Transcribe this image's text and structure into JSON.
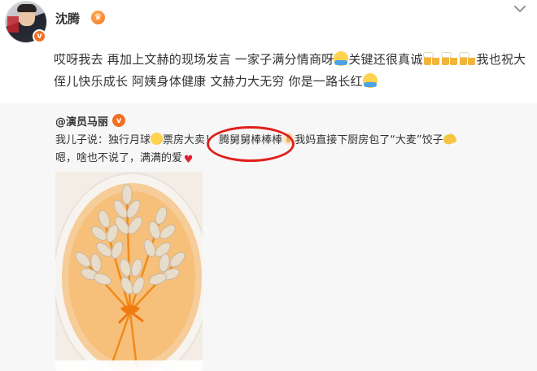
{
  "post": {
    "username": "沈腾",
    "verified_badge": "v",
    "crown_icon": "crown-icon",
    "menu_icon": "chevron-down-icon",
    "text_part1": "哎呀我去 再加上文赫的现场发言 一家子满分情商呀",
    "text_part2": "关键还很真诚",
    "text_part3": "我也祝大侄儿快乐成长 阿姨身体健康 文赫力大无穷 你是一路长红",
    "emojis": [
      "hug-emoji",
      "beer-emoji",
      "beer-emoji",
      "beer-emoji",
      "hug-emoji"
    ]
  },
  "repost": {
    "username": "@演员马丽",
    "verified_badge": "v",
    "line1_part1": "我儿子说：独行月球",
    "line1_part2": "票房大卖！",
    "line1_part3": "腾舅舅棒棒棒",
    "line1_part4": "我妈直接下厨房包了“大麦”饺子",
    "line2": "嗯，啥也不说了，满满的爱",
    "emojis": [
      "moon-emoji",
      "thumb-emoji",
      "taco-emoji",
      "heart-emoji"
    ]
  },
  "image": {
    "subject": "dumplings arranged as wheat ears on a plate"
  },
  "colors": {
    "accent": "#f36f21",
    "highlight": "#e0201c",
    "repost_bg": "#f7f7f7",
    "text": "#333333"
  }
}
